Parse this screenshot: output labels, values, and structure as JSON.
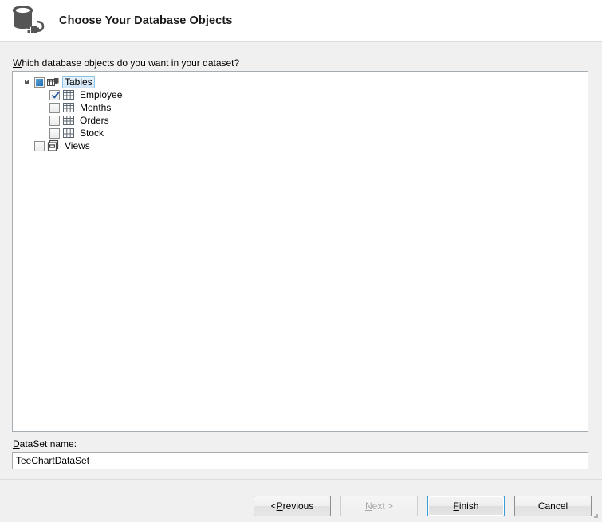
{
  "header": {
    "title": "Choose Your Database Objects",
    "icon": "database-connection-icon"
  },
  "main": {
    "prompt_accel": "W",
    "prompt_rest": "hich database objects do you want in your dataset?",
    "tree": {
      "nodes": [
        {
          "label": "Tables",
          "icon": "tables-folder-icon",
          "check_state": "indeterminate",
          "expanded": true,
          "selected": true,
          "has_twisty": true,
          "children": [
            {
              "label": "Employee",
              "icon": "table-icon",
              "check_state": "checked",
              "expanded": false,
              "has_twisty": true
            },
            {
              "label": "Months",
              "icon": "table-icon",
              "check_state": "unchecked",
              "expanded": false,
              "has_twisty": true
            },
            {
              "label": "Orders",
              "icon": "table-icon",
              "check_state": "unchecked",
              "expanded": false,
              "has_twisty": true
            },
            {
              "label": "Stock",
              "icon": "table-icon",
              "check_state": "unchecked",
              "expanded": false,
              "has_twisty": true
            }
          ]
        },
        {
          "label": "Views",
          "icon": "views-folder-icon",
          "check_state": "unchecked",
          "expanded": false,
          "selected": false,
          "has_twisty": false,
          "children": []
        }
      ]
    }
  },
  "dataset": {
    "label_accel": "D",
    "label_rest": "ataSet name:",
    "value": "TeeChartDataSet",
    "placeholder": ""
  },
  "footer": {
    "buttons": [
      {
        "name": "previous",
        "prefix": "< ",
        "accel": "P",
        "suffix": "revious",
        "state": "enabled"
      },
      {
        "name": "next",
        "prefix": "",
        "accel": "N",
        "suffix": "ext >",
        "state": "disabled"
      },
      {
        "name": "finish",
        "prefix": "",
        "accel": "F",
        "suffix": "inish",
        "state": "default"
      },
      {
        "name": "cancel",
        "prefix": "",
        "accel": "",
        "suffix": "Cancel",
        "state": "enabled"
      }
    ]
  },
  "colors": {
    "accent": "#3c9bd8",
    "selection_border": "#8ec2e5",
    "panel_border": "#a5acb2",
    "body_bg": "#f0f0f0",
    "header_bg": "#ffffff",
    "icon_gray": "#555555"
  }
}
